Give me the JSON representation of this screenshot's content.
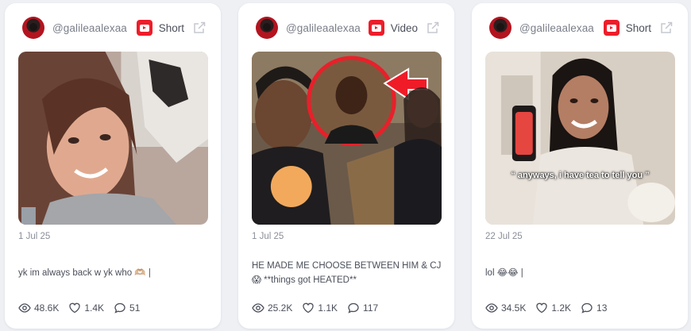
{
  "cards": [
    {
      "handle": "@galileaalexaa",
      "type_label": "Short",
      "date": "1 Jul 25",
      "description": "yk im always back w yk who 🫶🏼 |",
      "overlay_text": "",
      "views": "48.6K",
      "likes": "1.4K",
      "comments": "51"
    },
    {
      "handle": "@galileaalexaa",
      "type_label": "Video",
      "date": "1 Jul 25",
      "description": "HE MADE ME CHOOSE BETWEEN HIM & CJ 😱 **things got HEATED**",
      "overlay_text": "",
      "views": "25.2K",
      "likes": "1.1K",
      "comments": "117"
    },
    {
      "handle": "@galileaalexaa",
      "type_label": "Short",
      "date": "22 Jul 25",
      "description": "lol 😂😂 |",
      "overlay_text": "“ anyways, i have tea to tell you ”",
      "views": "34.5K",
      "likes": "1.2K",
      "comments": "13"
    }
  ],
  "colors": {
    "youtube_red": "#ee1d2a",
    "background": "#eef0f4",
    "card": "#ffffff"
  },
  "icons": [
    "youtube-icon",
    "external-link-icon",
    "eye-icon",
    "heart-icon",
    "comment-icon"
  ]
}
